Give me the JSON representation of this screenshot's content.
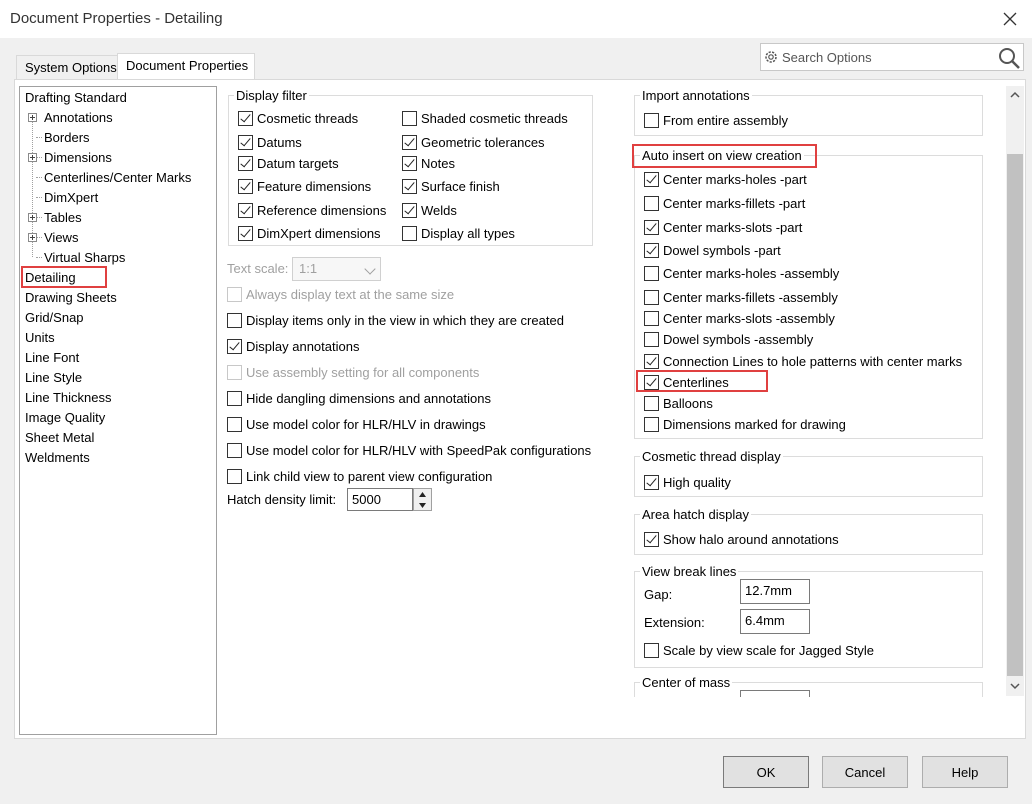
{
  "window": {
    "title": "Document Properties - Detailing"
  },
  "tabs": [
    {
      "label": "System Options",
      "active": false
    },
    {
      "label": "Document Properties",
      "active": true
    }
  ],
  "search": {
    "placeholder": "Search Options"
  },
  "tree": [
    {
      "label": "Drafting Standard",
      "selected": false
    },
    {
      "label": "Annotations",
      "expandable": true
    },
    {
      "label": "Borders"
    },
    {
      "label": "Dimensions",
      "expandable": true
    },
    {
      "label": "Centerlines/Center Marks"
    },
    {
      "label": "DimXpert"
    },
    {
      "label": "Tables",
      "expandable": true
    },
    {
      "label": "Views",
      "expandable": true
    },
    {
      "label": "Virtual Sharps"
    },
    {
      "label": "Detailing",
      "selected": true
    },
    {
      "label": "Drawing Sheets"
    },
    {
      "label": "Grid/Snap"
    },
    {
      "label": "Units"
    },
    {
      "label": "Line Font"
    },
    {
      "label": "Line Style"
    },
    {
      "label": "Line Thickness"
    },
    {
      "label": "Image Quality"
    },
    {
      "label": "Sheet Metal"
    },
    {
      "label": "Weldments"
    }
  ],
  "display_filter": {
    "title": "Display filter",
    "items": [
      {
        "label": "Cosmetic threads",
        "checked": true
      },
      {
        "label": "Shaded cosmetic threads",
        "checked": false
      },
      {
        "label": "Datums",
        "checked": true
      },
      {
        "label": "Geometric tolerances",
        "checked": true
      },
      {
        "label": "Datum targets",
        "checked": true
      },
      {
        "label": "Notes",
        "checked": true
      },
      {
        "label": "Feature dimensions",
        "checked": true
      },
      {
        "label": "Surface finish",
        "checked": true
      },
      {
        "label": "Reference dimensions",
        "checked": true
      },
      {
        "label": "Welds",
        "checked": true
      },
      {
        "label": "DimXpert dimensions",
        "checked": true
      },
      {
        "label": "Display all types",
        "checked": false
      }
    ]
  },
  "text_scale": {
    "label": "Text scale:",
    "value": "1:1"
  },
  "middle_options": [
    {
      "label": "Always display text at the same size",
      "checked": false,
      "disabled": true
    },
    {
      "label": "Display items only in the view in which they are created",
      "checked": false
    },
    {
      "label": "Display annotations",
      "checked": true
    },
    {
      "label": "Use assembly setting for all components",
      "checked": false,
      "disabled": true
    },
    {
      "label": "Hide dangling dimensions and annotations",
      "checked": false
    },
    {
      "label": "Use model color for HLR/HLV in drawings",
      "checked": false
    },
    {
      "label": "Use model color for HLR/HLV with SpeedPak configurations",
      "checked": false
    },
    {
      "label": "Link child view to parent view configuration",
      "checked": false
    }
  ],
  "hatch": {
    "label": "Hatch density limit:",
    "value": "5000"
  },
  "import_annotations": {
    "title": "Import annotations",
    "items": [
      {
        "label": "From entire assembly",
        "checked": false
      }
    ]
  },
  "auto_insert": {
    "title": "Auto insert on view creation",
    "items": [
      {
        "label": "Center marks-holes -part",
        "checked": true
      },
      {
        "label": "Center marks-fillets -part",
        "checked": false
      },
      {
        "label": "Center marks-slots  -part",
        "checked": true
      },
      {
        "label": "Dowel symbols -part",
        "checked": true
      },
      {
        "label": "Center marks-holes -assembly",
        "checked": false
      },
      {
        "label": "Center marks-fillets -assembly",
        "checked": false
      },
      {
        "label": "Center marks-slots  -assembly",
        "checked": false
      },
      {
        "label": "Dowel symbols -assembly",
        "checked": false
      },
      {
        "label": "Connection Lines to hole patterns with center marks",
        "checked": true
      },
      {
        "label": "Centerlines",
        "checked": true
      },
      {
        "label": "Balloons",
        "checked": false
      },
      {
        "label": "Dimensions marked for drawing",
        "checked": false
      }
    ]
  },
  "cosmetic_thread": {
    "title": "Cosmetic thread display",
    "items": [
      {
        "label": "High quality",
        "checked": true
      }
    ]
  },
  "area_hatch": {
    "title": "Area hatch display",
    "items": [
      {
        "label": "Show halo around annotations",
        "checked": true
      }
    ]
  },
  "view_break": {
    "title": "View break lines",
    "gap_label": "Gap:",
    "gap_value": "12.7mm",
    "extension_label": "Extension:",
    "extension_value": "6.4mm",
    "scale": {
      "label": "Scale by view scale for Jagged Style",
      "checked": false
    }
  },
  "center_of_mass": {
    "title": "Center of mass"
  },
  "buttons": {
    "ok": "OK",
    "cancel": "Cancel",
    "help": "Help"
  }
}
